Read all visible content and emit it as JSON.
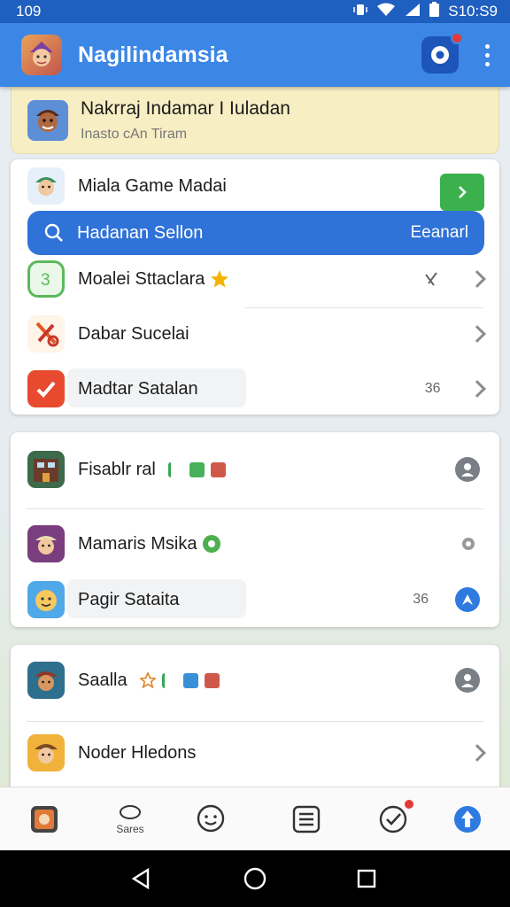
{
  "status": {
    "left": "109",
    "right": "S10:S9"
  },
  "appbar": {
    "title": "Nagilindamsia"
  },
  "banner": {
    "title": "Nakrraj Indamar I Iuladan",
    "subtitle": "Inasto cAn Tiram"
  },
  "menu_card": {
    "header": "Miala Game Madai",
    "search": {
      "value": "Hadanan Sellon",
      "action": "Eeanarl"
    },
    "items": [
      {
        "label": "Moalei Sttaclara",
        "trailing": ""
      },
      {
        "label": "Dabar Sucelai",
        "trailing": ""
      },
      {
        "label": "Madtar Satalan",
        "trailing": "36 "
      }
    ]
  },
  "list_card_1": {
    "items": [
      {
        "label": "Fisablr ral"
      },
      {
        "label": "Mamaris Msika"
      },
      {
        "label": "Pagir Sataita",
        "trailing": "36"
      }
    ]
  },
  "list_card_2": {
    "items": [
      {
        "label": "Saalla"
      },
      {
        "label": "Noder Hledons"
      }
    ]
  },
  "bottom_nav": [
    {
      "name": "home",
      "label": ""
    },
    {
      "name": "scores",
      "label": "Sares"
    },
    {
      "name": "chat",
      "label": ""
    },
    {
      "name": "list",
      "label": ""
    },
    {
      "name": "tasks",
      "label": ""
    },
    {
      "name": "upload",
      "label": ""
    }
  ],
  "colors": {
    "appbar": "#3c86e6",
    "statusbar": "#1f5fbf",
    "accent_green": "#3ab14d",
    "search_bg": "#2f72d8",
    "banner": "#f7eec4"
  }
}
